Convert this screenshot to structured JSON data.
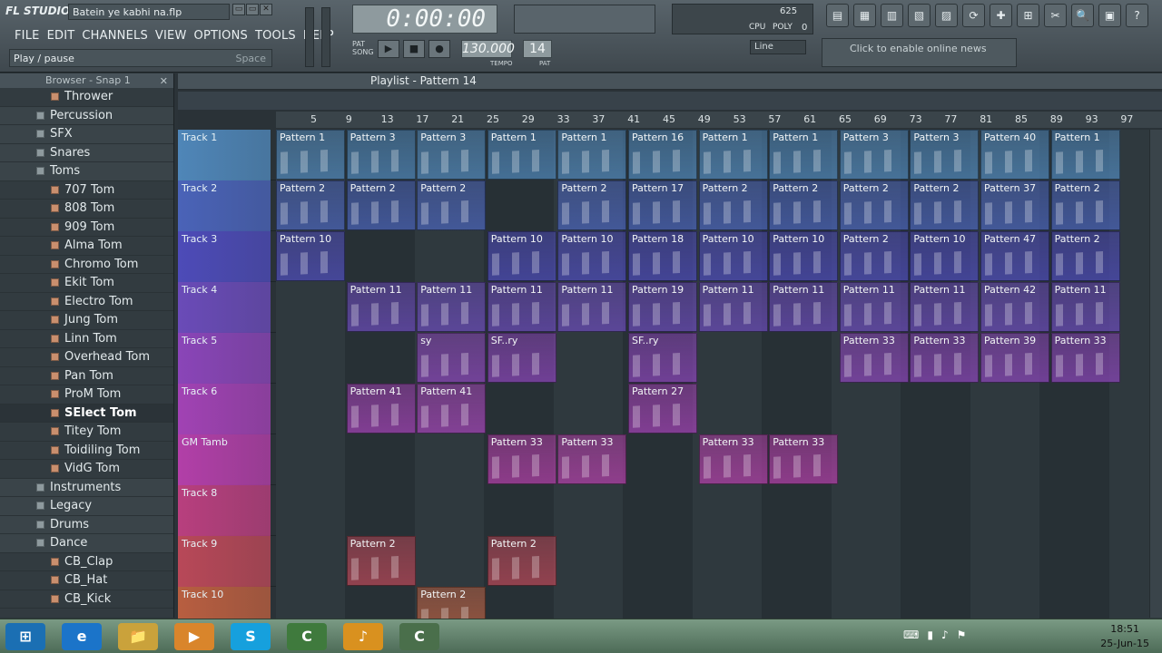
{
  "app": {
    "logo": "FL STUDIO",
    "filename": "Batein ye kabhi na.flp",
    "win_buttons": [
      "▭",
      "▭",
      "✕"
    ]
  },
  "menu": [
    "FILE",
    "EDIT",
    "CHANNELS",
    "VIEW",
    "OPTIONS",
    "TOOLS",
    "HELP"
  ],
  "hint": {
    "text": "Play / pause",
    "right": "Space"
  },
  "transport": {
    "time": "0:00:00",
    "tempo": "130.000",
    "tempo_label": "TEMPO",
    "pattern": "14",
    "pattern_label": "PAT",
    "pat_label": "PAT",
    "song_label": "SONG",
    "play": "▶",
    "stop": "■",
    "rec": "●"
  },
  "snap": "Line",
  "cpu": {
    "labels": [
      "CPU",
      "POLY"
    ],
    "values": [
      "625",
      "0"
    ]
  },
  "news": "Click to enable online news",
  "tools": [
    "▤",
    "▦",
    "▥",
    "▧",
    "▨",
    "⟳",
    "✚",
    "⊞",
    "✂",
    "🔍",
    "▣",
    "?"
  ],
  "browser": {
    "title": "Browser - Snap 1",
    "close": "✕",
    "items": [
      {
        "label": "Thrower",
        "type": "file"
      },
      {
        "label": "Percussion",
        "type": "folder"
      },
      {
        "label": "SFX",
        "type": "folder"
      },
      {
        "label": "Snares",
        "type": "folder"
      },
      {
        "label": "Toms",
        "type": "folder"
      },
      {
        "label": "707 Tom",
        "type": "file"
      },
      {
        "label": "808 Tom",
        "type": "file"
      },
      {
        "label": "909 Tom",
        "type": "file"
      },
      {
        "label": "Alma Tom",
        "type": "file"
      },
      {
        "label": "Chromo Tom",
        "type": "file"
      },
      {
        "label": "Ekit Tom",
        "type": "file"
      },
      {
        "label": "Electro Tom",
        "type": "file"
      },
      {
        "label": "Jung Tom",
        "type": "file"
      },
      {
        "label": "Linn Tom",
        "type": "file"
      },
      {
        "label": "Overhead Tom",
        "type": "file"
      },
      {
        "label": "Pan Tom",
        "type": "file"
      },
      {
        "label": "ProM Tom",
        "type": "file"
      },
      {
        "label": "SElect Tom",
        "type": "selected"
      },
      {
        "label": "Titey Tom",
        "type": "file"
      },
      {
        "label": "Toidiling Tom",
        "type": "file"
      },
      {
        "label": "VidG Tom",
        "type": "file"
      },
      {
        "label": "Instruments",
        "type": "folder"
      },
      {
        "label": "Legacy",
        "type": "folder"
      },
      {
        "label": "Drums",
        "type": "folder"
      },
      {
        "label": "Dance",
        "type": "folder"
      },
      {
        "label": "CB_Clap",
        "type": "file"
      },
      {
        "label": "CB_Hat",
        "type": "file"
      },
      {
        "label": "CB_Kick",
        "type": "file"
      }
    ]
  },
  "playlist": {
    "title": "Playlist - Pattern 14",
    "ruler": [
      "5",
      "9",
      "13",
      "17",
      "21",
      "25",
      "29",
      "33",
      "37",
      "41",
      "45",
      "49",
      "53",
      "57",
      "61",
      "65",
      "69",
      "73",
      "77",
      "81",
      "85",
      "89",
      "93",
      "97"
    ],
    "tracks": [
      {
        "name": "Track 1",
        "color": "#4f86b8",
        "clips": [
          "Pattern 1",
          "Pattern 3",
          "Pattern 3",
          "Pattern 1",
          "Pattern 1",
          "Pattern 16",
          "Pattern 1",
          "Pattern 1",
          "Pattern 3",
          "Pattern 3",
          "Pattern 40",
          "Pattern 1"
        ]
      },
      {
        "name": "Track 2",
        "color": "#4a63b8",
        "clips": [
          "Pattern 2",
          "Pattern 2",
          "Pattern 2",
          "",
          "Pattern 2",
          "Pattern 17",
          "Pattern 2",
          "Pattern 2",
          "Pattern 2",
          "Pattern 2",
          "Pattern 37",
          "Pattern 2"
        ]
      },
      {
        "name": "Track 3",
        "color": "#4d4bb8",
        "clips": [
          "Pattern 10",
          "",
          "",
          "Pattern 10",
          "Pattern 10",
          "Pattern 18",
          "Pattern 10",
          "Pattern 10",
          "Pattern 2",
          "Pattern 10",
          "Pattern 47",
          "Pattern 2"
        ]
      },
      {
        "name": "Track 4",
        "color": "#6a4bb8",
        "clips": [
          "",
          "Pattern 11",
          "Pattern 11",
          "Pattern 11",
          "Pattern 11",
          "Pattern 19",
          "Pattern 11",
          "Pattern 11",
          "Pattern 11",
          "Pattern 11",
          "Pattern 42",
          "Pattern 11"
        ]
      },
      {
        "name": "Track 5",
        "color": "#8a45b8",
        "clips": [
          "",
          "",
          "sy",
          "SF..ry",
          "",
          "SF..ry",
          "",
          "",
          "Pattern 33",
          "Pattern 33",
          "Pattern 39",
          "Pattern 33"
        ]
      },
      {
        "name": "Track 6",
        "color": "#a142b4",
        "clips": [
          "",
          "Pattern 41",
          "Pattern 41",
          "",
          "",
          "Pattern 27",
          "",
          "",
          "",
          "",
          "",
          ""
        ]
      },
      {
        "name": "GM Tamb",
        "color": "#b23fa8",
        "clips": [
          "",
          "",
          "",
          "Pattern 33",
          "Pattern 33",
          "",
          "Pattern 33",
          "Pattern 33",
          "",
          "",
          "",
          ""
        ]
      },
      {
        "name": "Track 8",
        "color": "#b83f7e",
        "clips": [
          "",
          "",
          "",
          "",
          "",
          "",
          "",
          "",
          "",
          "",
          "",
          ""
        ]
      },
      {
        "name": "Track 9",
        "color": "#b84858",
        "clips": [
          "",
          "Pattern 2",
          "",
          "Pattern 2",
          "",
          "",
          "",
          "",
          "",
          "",
          "",
          ""
        ]
      },
      {
        "name": "Track 10",
        "color": "#b85e40",
        "clips": [
          "",
          "",
          "Pattern 2",
          "",
          "",
          "",
          "",
          "",
          "",
          "",
          "",
          ""
        ]
      }
    ]
  },
  "taskbar": {
    "time": "18:51",
    "date": "25-Jun-15",
    "apps": [
      "⊞",
      "e",
      "📁",
      "▶",
      "S",
      "C",
      "♪",
      "C"
    ]
  }
}
